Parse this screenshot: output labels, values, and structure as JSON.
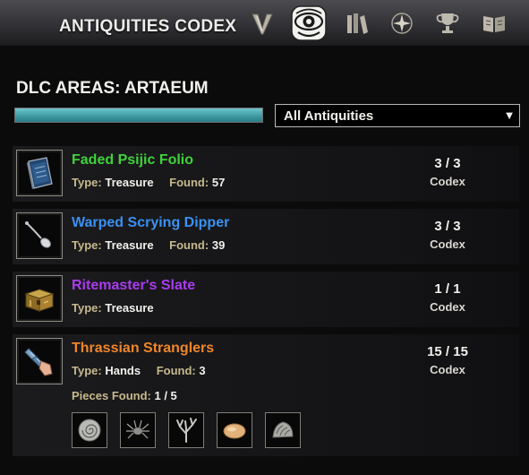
{
  "header": {
    "title": "ANTIQUITIES CODEX",
    "nav": [
      {
        "name": "skills-tab-icon",
        "icon": "v-emblem-icon"
      },
      {
        "name": "antiquities-tab-icon",
        "icon": "scrying-eye-icon",
        "active": true
      },
      {
        "name": "collections-tab-icon",
        "icon": "books-icon"
      },
      {
        "name": "champion-tab-icon",
        "icon": "constellation-icon"
      },
      {
        "name": "achievements-tab-icon",
        "icon": "trophy-icon"
      },
      {
        "name": "lore-tab-icon",
        "icon": "open-book-icon"
      }
    ]
  },
  "area": {
    "title": "DLC AREAS: ARTAEUM",
    "progress_fraction": 1.0,
    "filter": {
      "selected": "All Antiquities"
    }
  },
  "items": [
    {
      "name": "Faded Psijic Folio",
      "color": "#3fd23a",
      "type_label": "Type:",
      "type": "Treasure",
      "found_label": "Found:",
      "found": "57",
      "count": "3 / 3",
      "count_label": "Codex",
      "icon": "folio-book-icon"
    },
    {
      "name": "Warped Scrying Dipper",
      "color": "#3a91f2",
      "type_label": "Type:",
      "type": "Treasure",
      "found_label": "Found:",
      "found": "39",
      "count": "3 / 3",
      "count_label": "Codex",
      "icon": "dipper-spoon-icon"
    },
    {
      "name": "Ritemaster's Slate",
      "color": "#a93cf0",
      "type_label": "Type:",
      "type": "Treasure",
      "count": "1 / 1",
      "count_label": "Codex",
      "icon": "treasure-chest-icon"
    },
    {
      "name": "Thrassian Stranglers",
      "color": "#f0862a",
      "type_label": "Type:",
      "type": "Hands",
      "found_label": "Found:",
      "found": "3",
      "count": "15 / 15",
      "count_label": "Codex",
      "icon": "gauntlet-icon",
      "pieces_label": "Pieces Found:",
      "pieces_value": "1 / 5",
      "pieces": [
        "fossil-shell-icon",
        "spider-fossil-icon",
        "coral-branch-icon",
        "amber-stone-icon",
        "coral-rock-icon"
      ]
    }
  ]
}
